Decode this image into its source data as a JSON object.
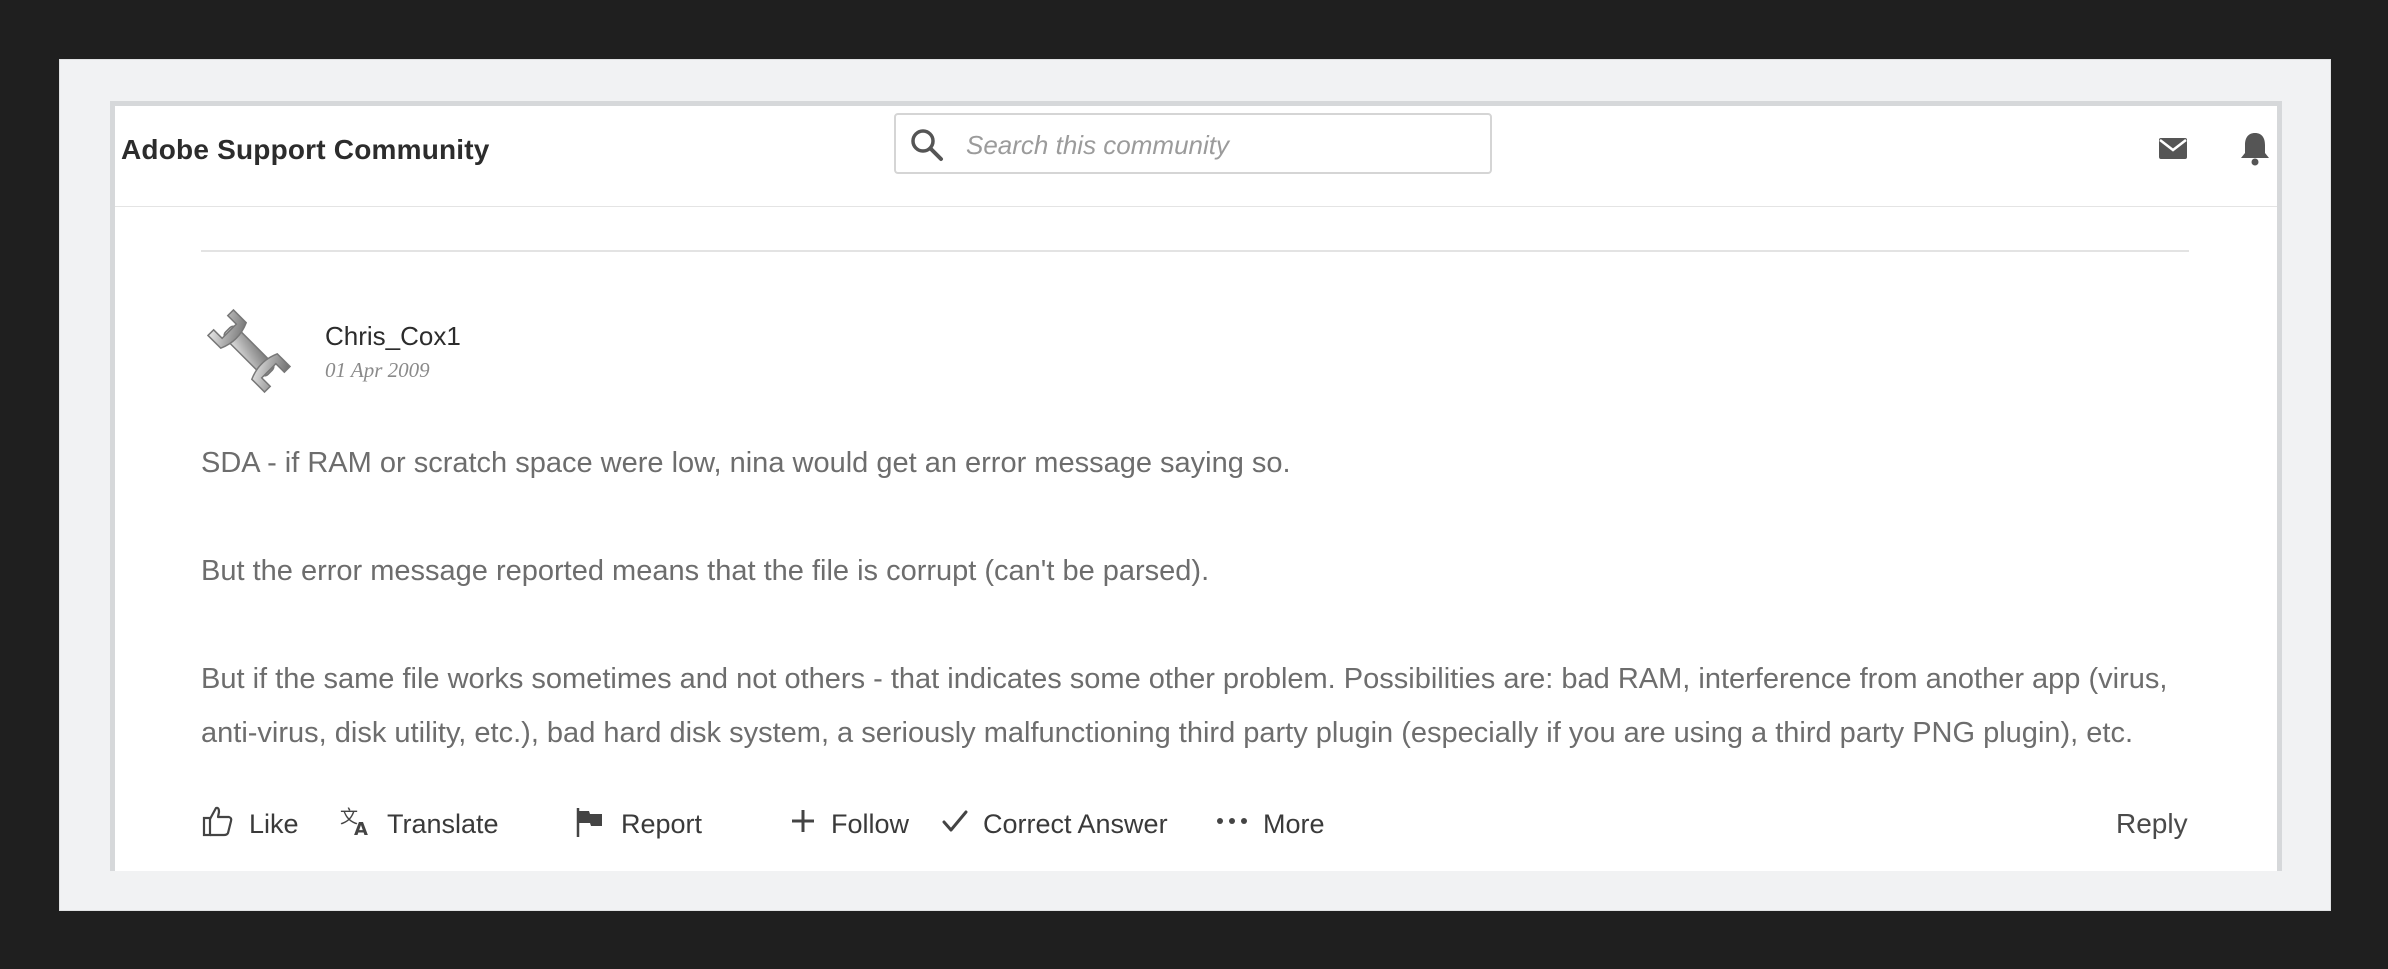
{
  "header": {
    "site_title": "Adobe Support Community",
    "search_placeholder": "Search this community"
  },
  "icons": {
    "search": "search-icon",
    "mail": "mail-icon",
    "notifications": "bell-icon",
    "avatar": "wrench-icon"
  },
  "post": {
    "author": "Chris_Cox1",
    "date": "01 Apr 2009",
    "paragraphs": [
      "SDA - if RAM or scratch space were low, nina would get an error message saying so.",
      "But the error message reported means that the file is corrupt (can't be parsed).",
      "But if the same file works sometimes and not others - that indicates some other problem. Possibilities are: bad RAM, interference from another app (virus, anti-virus, disk utility, etc.), bad hard disk system, a seriously malfunctioning third party plugin (especially if you are using a third party PNG plugin), etc."
    ]
  },
  "actions": {
    "like": "Like",
    "translate": "Translate",
    "report": "Report",
    "follow": "Follow",
    "correct_answer": "Correct Answer",
    "more": "More",
    "reply": "Reply"
  },
  "colors": {
    "background_outer": "#1f1f1f",
    "frame": "#f1f2f3",
    "text_dark": "#2c2c2c",
    "text_body": "#6d6d6d",
    "icon_gray": "#555555"
  }
}
